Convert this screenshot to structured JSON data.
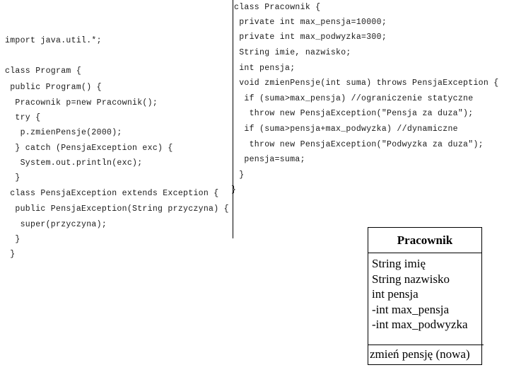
{
  "left_code": {
    "lines": [
      "import java.util.*;",
      "class Program {",
      " public Program() {",
      "  Pracownik p=new Pracownik();",
      "  try {",
      "   p.zmienPensje(2000);",
      "  } catch (PensjaException exc) {",
      "   System.out.println(exc);",
      "  }",
      " class PensjaException extends Exception {",
      "  public PensjaException(String przyczyna) {",
      "   super(przyczyna);",
      "  }",
      " }"
    ]
  },
  "right_code": {
    "lines": [
      "class Pracownik {",
      " private int max_pensja=10000;",
      " private int max_podwyzka=300;",
      " String imie, nazwisko;",
      " int pensja;",
      " void zmienPensje(int suma) throws PensjaException {",
      "  if (suma>max_pensja) //ograniczenie statyczne",
      "   throw new PensjaException(\"Pensja za duza\");",
      "  if (suma>pensja+max_podwyzka) //dynamiczne",
      "   throw new PensjaException(\"Podwyzka za duza\");",
      "  pensja=suma;",
      " }",
      "}"
    ]
  },
  "uml": {
    "class_name": "Pracownik",
    "attributes": [
      "String imię",
      "String nazwisko",
      "int pensja",
      "-int max_pensja",
      "-int max_podwyzka"
    ],
    "methods": [
      "zmień pensję (nowa)"
    ]
  }
}
